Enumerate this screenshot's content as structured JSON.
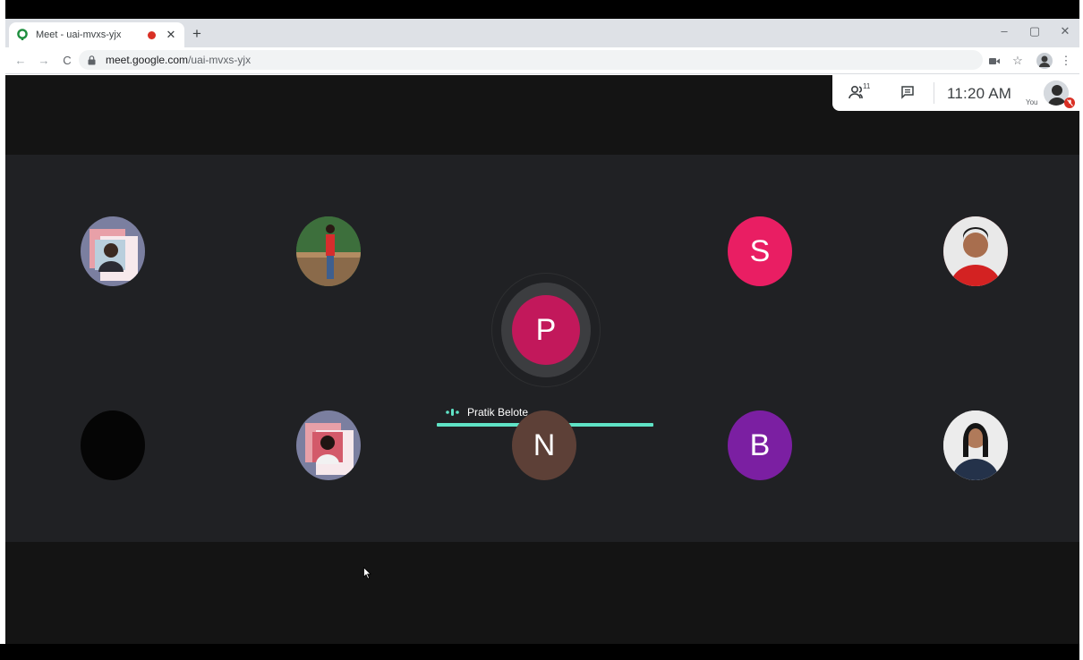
{
  "browser": {
    "tab": {
      "title": "Meet - uai-mvxs-yjx",
      "recording": true
    },
    "new_tab_label": "+",
    "window_controls": {
      "minimize": "–",
      "maximize": "▢",
      "close": "✕"
    },
    "nav": {
      "back": "←",
      "forward": "→",
      "reload": "C"
    },
    "url": {
      "host": "meet.google.com",
      "path": "/uai-mvxs-yjx"
    },
    "toolbar_icons": [
      "camera-icon",
      "star-icon",
      "profile-avatar",
      "more-icon"
    ]
  },
  "meet": {
    "info_bar": {
      "participant_count": "11",
      "time": "11:20 AM",
      "self_label": "You"
    },
    "participants": [
      {
        "id": "p1",
        "type": "photo",
        "bg": "#7b7fa0"
      },
      {
        "id": "p2",
        "type": "photo",
        "bg": "#3f6a3a"
      },
      {
        "id": "p3",
        "type": "initial",
        "initial": "P",
        "color": "#c2185b",
        "speaking": true
      },
      {
        "id": "p4",
        "type": "initial",
        "initial": "S",
        "color": "#e91e63"
      },
      {
        "id": "p5",
        "type": "photo",
        "bg": "#c62828"
      },
      {
        "id": "p6",
        "type": "blank",
        "bg": "#050505"
      },
      {
        "id": "p7",
        "type": "photo",
        "bg": "#7b7fa0"
      },
      {
        "id": "p8",
        "type": "initial",
        "initial": "N",
        "color": "#5d4037"
      },
      {
        "id": "p9",
        "type": "initial",
        "initial": "B",
        "color": "#7b1fa2"
      },
      {
        "id": "p10",
        "type": "photo",
        "bg": "#e0e0e0"
      }
    ],
    "speaker_name": "Pratik Belote",
    "accent": "#5fe3c6"
  }
}
